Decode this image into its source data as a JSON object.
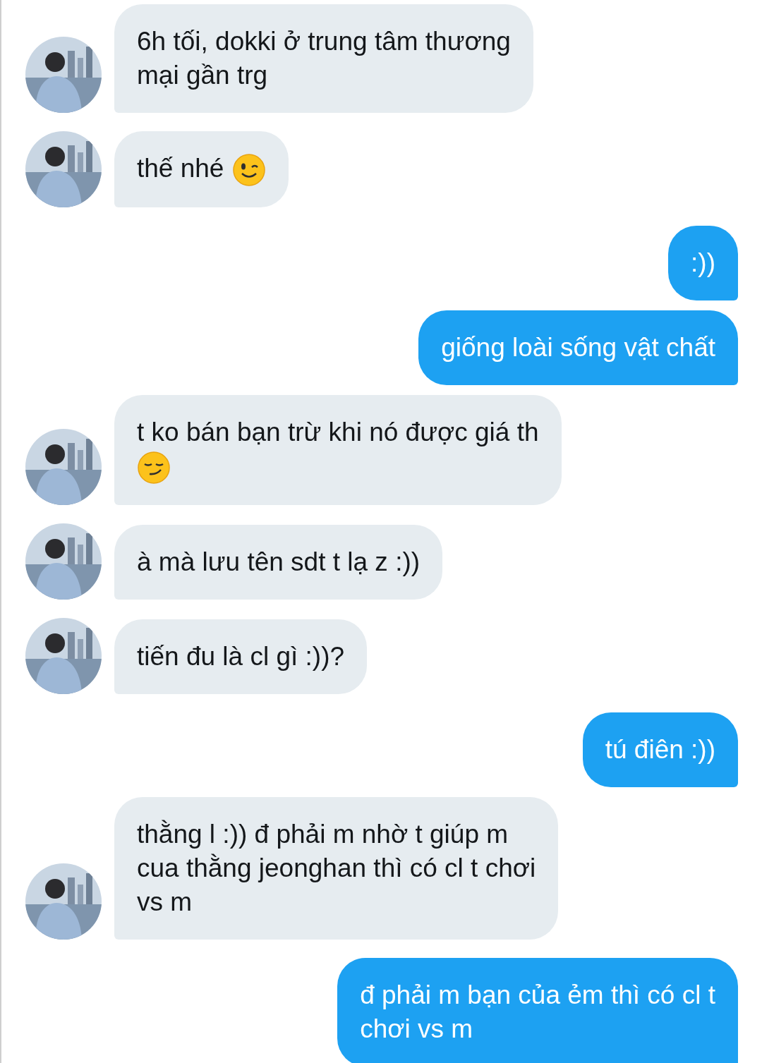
{
  "messages": [
    {
      "kind": "received",
      "lines": [
        "6h tối, dokki ở trung tâm thương",
        "mại gần trg"
      ]
    },
    {
      "kind": "received",
      "lines": [
        "thế nhé"
      ],
      "emoji": {
        "kind": "wink"
      }
    },
    {
      "kind": "sent",
      "lines": [
        ":))"
      ]
    },
    {
      "kind": "sent",
      "lines": [
        "giống loài sống vật chất"
      ]
    },
    {
      "kind": "received",
      "lines": [
        "t ko bán bạn trừ khi nó được giá th"
      ],
      "emoji": {
        "kind": "smirk"
      }
    },
    {
      "kind": "received",
      "lines": [
        "à mà lưu tên sdt t lạ z :))"
      ]
    },
    {
      "kind": "received",
      "lines": [
        "tiến đu là cl gì :))?"
      ]
    },
    {
      "kind": "sent",
      "lines": [
        "tú điên :))"
      ]
    },
    {
      "kind": "received",
      "lines": [
        "thằng l :)) đ phải m nhờ t giúp m",
        "cua thằng jeonghan thì có cl t chơi",
        "vs m"
      ]
    },
    {
      "kind": "sent",
      "lines": [
        "đ phải m bạn của ẻm thì có cl t",
        "chơi vs m"
      ]
    }
  ]
}
